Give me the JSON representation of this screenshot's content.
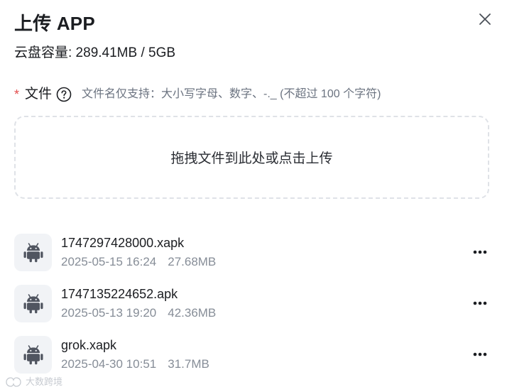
{
  "dialog": {
    "title": "上传 APP",
    "storage": "云盘容量: 289.41MB / 5GB"
  },
  "field": {
    "required_mark": "*",
    "label": "文件",
    "hint": "文件名仅支持：大小写字母、数字、-._ (不超过 100 个字符)"
  },
  "dropzone": {
    "text": "拖拽文件到此处或点击上传"
  },
  "files": [
    {
      "name": "1747297428000.xapk",
      "datetime": "2025-05-15 16:24",
      "size": "27.68MB",
      "icon": "android-icon"
    },
    {
      "name": "1747135224652.apk",
      "datetime": "2025-05-13 19:20",
      "size": "42.36MB",
      "icon": "android-icon"
    },
    {
      "name": "grok.xapk",
      "datetime": "2025-04-30 10:51",
      "size": "31.7MB",
      "icon": "android-icon"
    }
  ],
  "watermark": {
    "text": "大数跨境"
  },
  "colors": {
    "required": "#e34d4d",
    "hint": "#6b7380",
    "meta": "#868d97",
    "border": "#dfe2e7",
    "thumb_bg": "#f1f3f6"
  }
}
